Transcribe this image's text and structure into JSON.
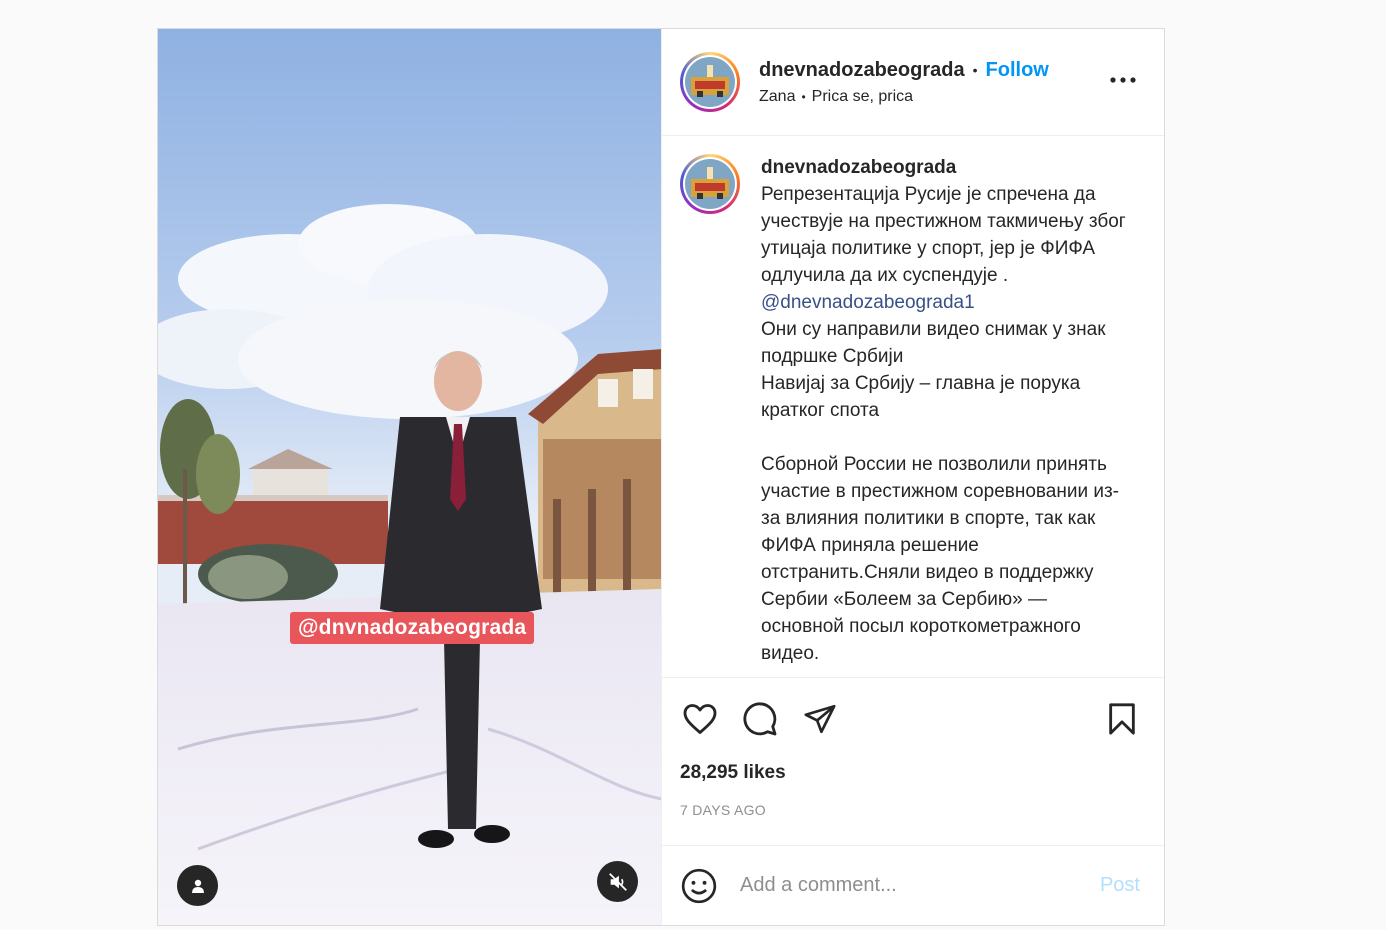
{
  "header": {
    "username": "dnevnadozabeograda",
    "separator": "•",
    "follow_label": "Follow",
    "audio_artist": "Zana",
    "audio_track": "Prica se, prica",
    "more_icon": "more-horizontal-icon"
  },
  "media": {
    "watermark": "@dnvnadozabeograda",
    "tag_icon": "user-tag-icon",
    "mute_icon": "audio-muted-icon"
  },
  "caption": {
    "username": "dnevnadozabeograda",
    "text_part1": "Репрезентација Русије је спречена да учествује на престижном такмичењу због утицаја политике у спорт, јер је ФИФА одлучила да их суспендује . ",
    "mention": "@dnevnadozabeograda1",
    "text_part2": "\nОни су направили видео снимак у знак подршке Србији\nНавијај за Србију – главна је порука кратког спота\n\nСборной России не позволили принять участие в престижном соревновании из-за влияния политики в спорте, так как ФИФА приняла решение отстранить.Сняли видео в поддержку Сербии «Болеем за Сербию» — основной посыл короткометражного видео."
  },
  "actions": {
    "like_icon": "heart-icon",
    "comment_icon": "comment-icon",
    "share_icon": "send-icon",
    "save_icon": "bookmark-icon"
  },
  "stats": {
    "likes": "28,295 likes",
    "time_ago": "7 DAYS AGO"
  },
  "comment_box": {
    "placeholder": "Add a comment...",
    "post_label": "Post",
    "emoji_icon": "smile-icon"
  },
  "colors": {
    "accent": "#0095f6",
    "post_disabled": "#b2dffc",
    "mention": "#385185",
    "watermark_bg": "#e8555a"
  }
}
